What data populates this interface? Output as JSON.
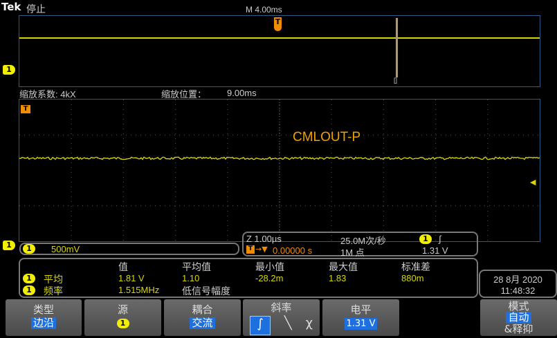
{
  "header": {
    "brand": "Tek",
    "status": "停止",
    "timebase": "M 4.00ms"
  },
  "overview": {
    "trigger_marker": "T",
    "zoom_marker": "[]",
    "channel_marker": "1"
  },
  "zoom": {
    "factor_label": "缩放系数: 4kX",
    "position_label": "缩放位置：",
    "position_value": "9.00ms"
  },
  "main": {
    "trigger_marker": "T",
    "signal_label": "CMLOUT-P",
    "channel_marker": "1"
  },
  "channel_readout": {
    "channel": "1",
    "scale": "500mV"
  },
  "timebase_readout": {
    "zoom_scale": "Z 1.00µs",
    "sample_rate": "25.0M次/秒",
    "trigger_channel": "1",
    "trigger_slope": "∫",
    "trigger_position": "0.00000 s",
    "record_length": "1M 点",
    "trigger_level": "1.31 V"
  },
  "measurements": {
    "headers": [
      "值",
      "平均值",
      "最小值",
      "最大值",
      "标准差"
    ],
    "rows": [
      {
        "channel": "1",
        "name": "平均",
        "value": "1.81 V",
        "mean": "1.10",
        "min": "-28.2m",
        "max": "1.83",
        "std": "880m"
      },
      {
        "channel": "1",
        "name": "频率",
        "value": "1.515MHz",
        "note": "低信号幅度"
      }
    ]
  },
  "datetime": {
    "date": "28 8月 2020",
    "time": "11:48:32"
  },
  "buttons": {
    "type": {
      "label": "类型",
      "value": "边沿"
    },
    "source": {
      "label": "源",
      "value": "1"
    },
    "coupling": {
      "label": "耦合",
      "value": "交流"
    },
    "slope": {
      "label": "斜率"
    },
    "level": {
      "label": "电平",
      "value": "1.31 V"
    },
    "mode": {
      "label": "模式",
      "value": "自动",
      "sub": "&释抑"
    }
  },
  "colors": {
    "trace": "#d8d800",
    "accent": "#1e6fe0",
    "trigger": "#f08c00",
    "border": "#2f5a86"
  }
}
